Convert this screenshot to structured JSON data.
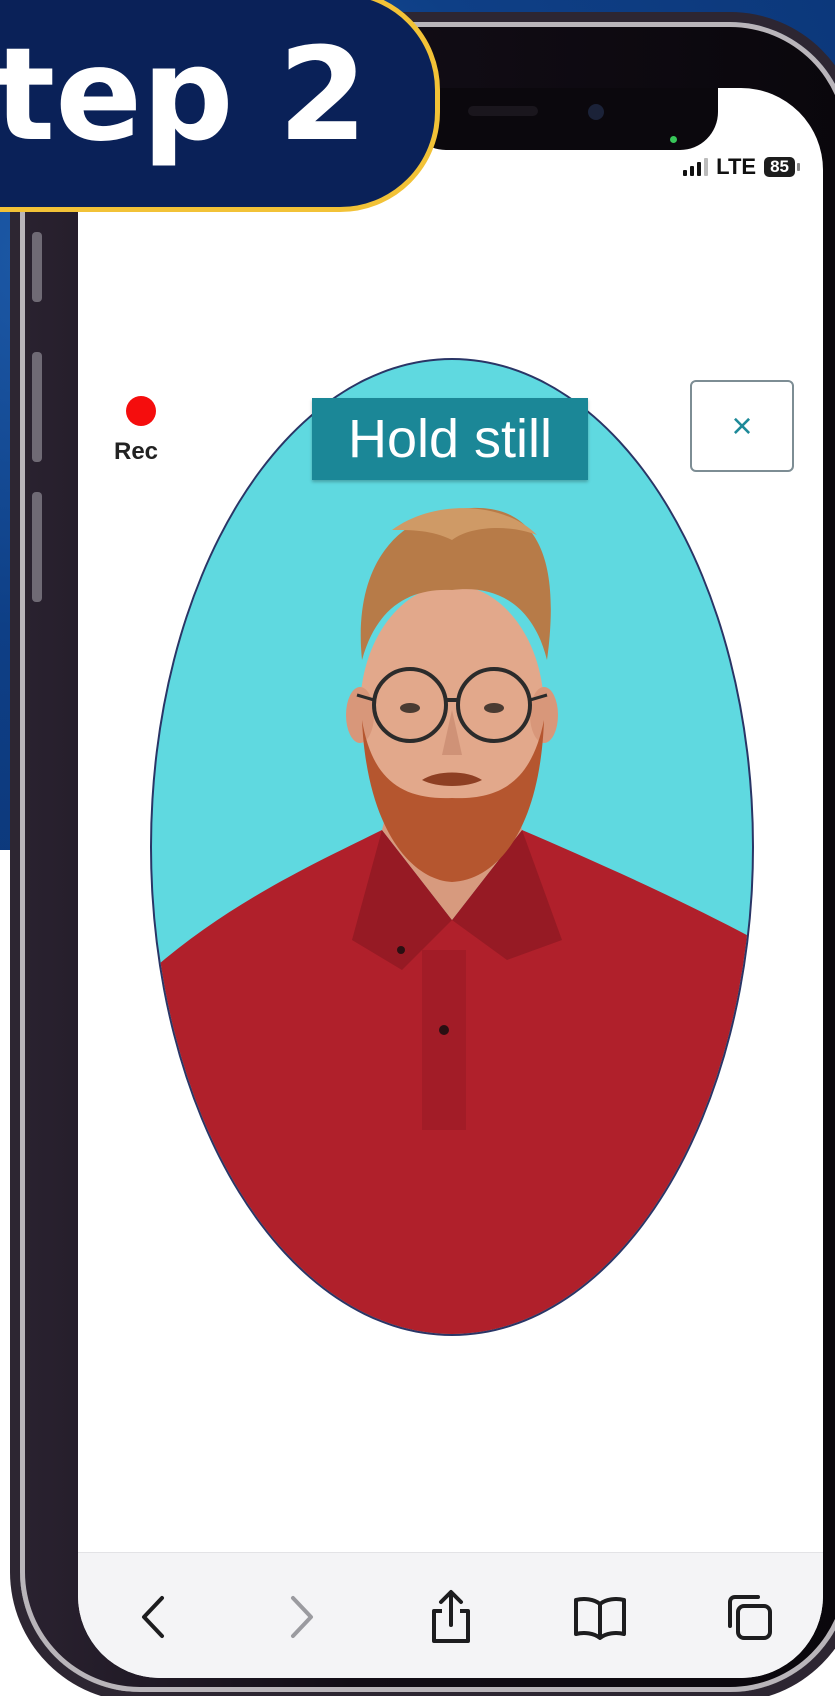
{
  "badge": {
    "text": "tep 2"
  },
  "status_bar": {
    "network": "LTE",
    "battery": "85"
  },
  "recording": {
    "label": "Rec"
  },
  "capture": {
    "prompt": "Hold still",
    "close_symbol": "×"
  },
  "toolbar": {
    "items": [
      {
        "icon": "chevron-left-icon"
      },
      {
        "icon": "chevron-right-icon"
      },
      {
        "icon": "share-icon"
      },
      {
        "icon": "bookmarks-icon"
      },
      {
        "icon": "tabs-icon"
      }
    ]
  },
  "colors": {
    "badge_bg": "#0a2158",
    "badge_border": "#f2c237",
    "oval_bg": "#5fd9e0",
    "prompt_bg": "#1b8797",
    "rec": "#f50d0d",
    "shirt": "#b0202b"
  }
}
